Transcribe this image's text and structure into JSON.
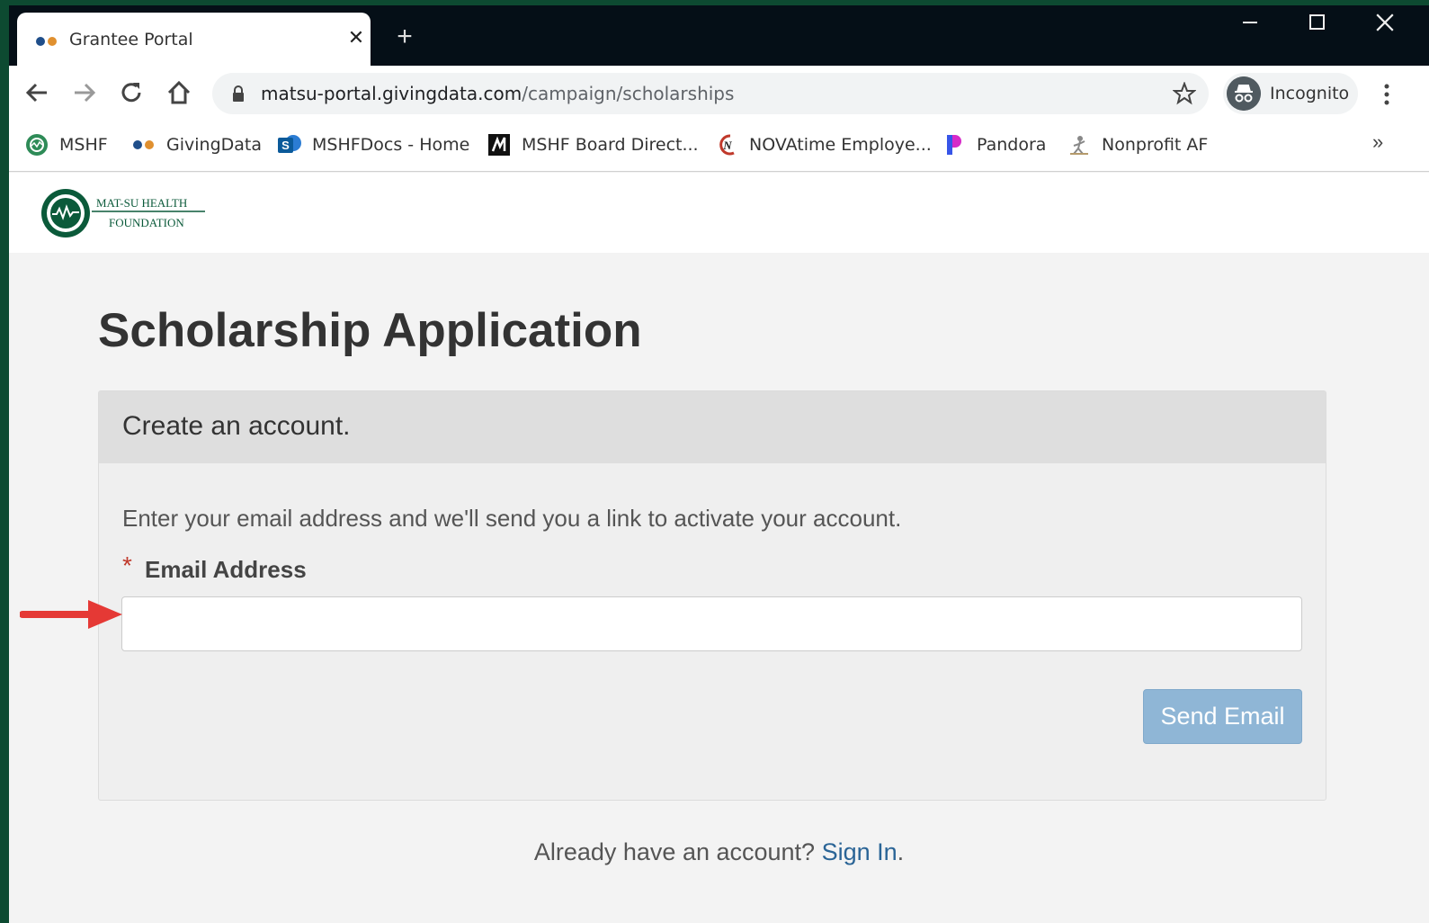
{
  "browser": {
    "tab": {
      "title": "Grantee Portal",
      "close": "✕"
    },
    "new_tab": "+",
    "window_controls": {
      "minimize": "–",
      "maximize": "☐",
      "close": "✕"
    },
    "url": {
      "domain": "matsu-portal.givingdata.com",
      "path": "/campaign/scholarships"
    },
    "incognito_label": "Incognito",
    "bookmarks": [
      {
        "label": "MSHF",
        "icon": "mshf-icon"
      },
      {
        "label": "GivingData",
        "icon": "givingdata-icon"
      },
      {
        "label": "MSHFDocs - Home",
        "icon": "sharepoint-icon"
      },
      {
        "label": "MSHF Board Direct...",
        "icon": "board-direct-icon"
      },
      {
        "label": "NOVAtime Employe...",
        "icon": "novatime-icon"
      },
      {
        "label": "Pandora",
        "icon": "pandora-icon"
      },
      {
        "label": "Nonprofit AF",
        "icon": "nonprofit-af-icon"
      }
    ],
    "bookmarks_more": "»"
  },
  "site": {
    "logo_text_line1": "MAT-SU HEALTH",
    "logo_text_line2": "FOUNDATION"
  },
  "page": {
    "title": "Scholarship Application",
    "card": {
      "heading": "Create an account.",
      "instructions": "Enter your email address and we'll send you a link to activate your account.",
      "required_marker": "*",
      "email_label": "Email Address",
      "email_value": "",
      "send_button": "Send Email"
    },
    "signin_prompt": "Already have an account?",
    "signin_link": "Sign In",
    "signin_suffix": "."
  },
  "colors": {
    "accent_link": "#2a6496",
    "button_disabled": "#8fb6d6",
    "annotation_arrow": "#e53935",
    "brand_green": "#0b5a3a"
  }
}
